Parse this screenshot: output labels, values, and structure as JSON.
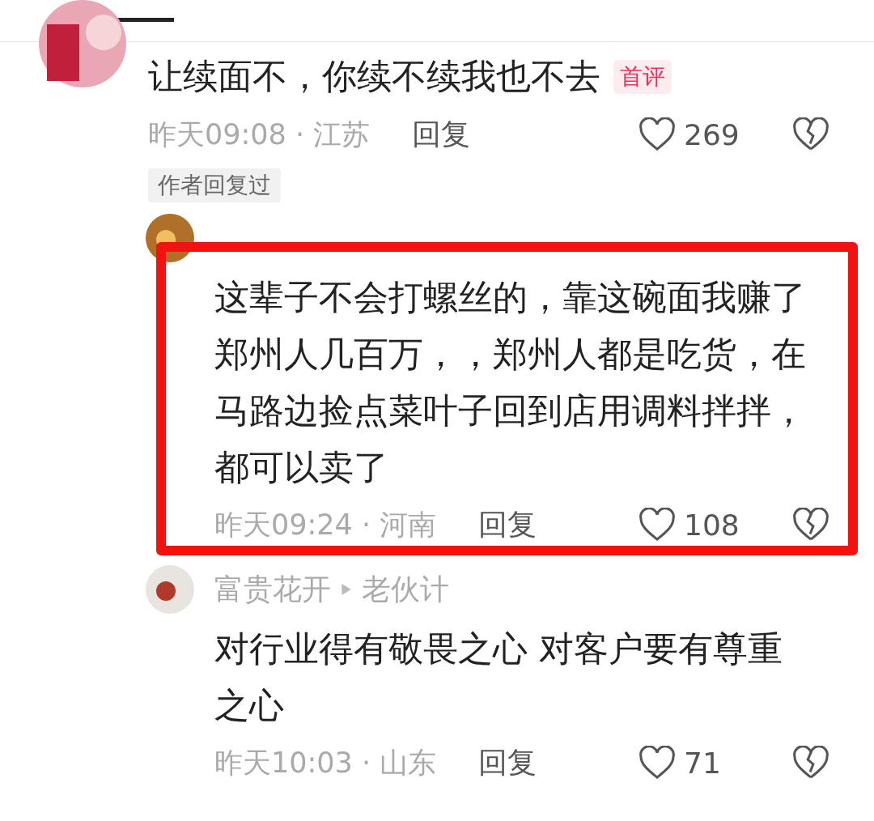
{
  "comment": {
    "text": "让续面不，你续不续我也不去",
    "badge": "首评",
    "time": "昨天09:08 · 江苏",
    "reply": "回复",
    "likes": "269",
    "author_replied": "作者回复过",
    "replies": [
      {
        "highlighted": true,
        "text": "这辈子不会打螺丝的，靠这碗面我赚了郑州人几百万，，郑州人都是吃货，在马路边捡点菜叶子回到店用调料拌拌，都可以卖了",
        "time": "昨天09:24 · 河南",
        "reply": "回复",
        "likes": "108"
      },
      {
        "author": "富贵花开",
        "reply_to": "老伙计",
        "highlighted": false,
        "text": "对行业得有敬畏之心 对客户要有尊重之心",
        "time": "昨天10:03 · 山东",
        "reply": "回复",
        "likes": "71"
      }
    ]
  }
}
